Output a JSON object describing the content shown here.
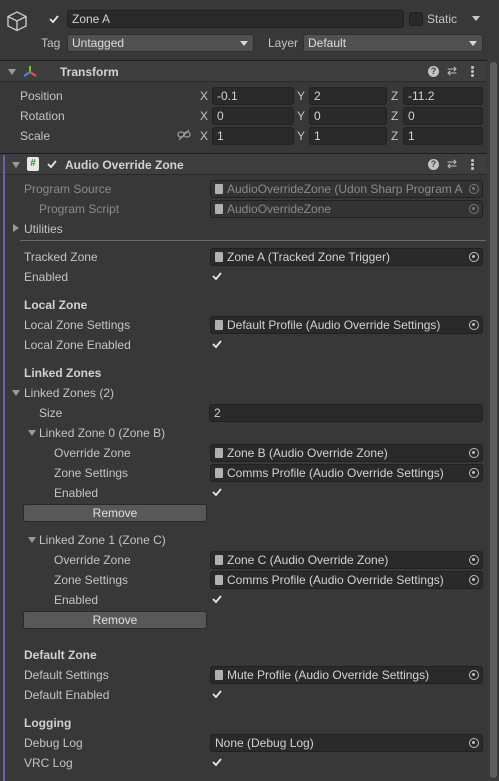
{
  "gameobject": {
    "active": true,
    "name": "Zone A",
    "static_label": "Static",
    "static_checked": false,
    "tag_label": "Tag",
    "tag_value": "Untagged",
    "layer_label": "Layer",
    "layer_value": "Default"
  },
  "transform": {
    "title": "Transform",
    "position_label": "Position",
    "rotation_label": "Rotation",
    "scale_label": "Scale",
    "axis": {
      "x": "X",
      "y": "Y",
      "z": "Z"
    },
    "position": {
      "x": "-0.1",
      "y": "2",
      "z": "-11.2"
    },
    "rotation": {
      "x": "0",
      "y": "0",
      "z": "0"
    },
    "scale": {
      "x": "1",
      "y": "1",
      "z": "1"
    }
  },
  "component": {
    "title": "Audio Override Zone",
    "enabled": true,
    "program_source_label": "Program Source",
    "program_source_value": "AudioOverrideZone (Udon Sharp Program A",
    "program_script_label": "Program Script",
    "program_script_value": "AudioOverrideZone",
    "utilities_label": "Utilities",
    "tracked_zone_label": "Tracked Zone",
    "tracked_zone_value": "Zone A (Tracked Zone Trigger)",
    "enabled_label": "Enabled",
    "enabled_checked": true,
    "local_zone_header": "Local Zone",
    "local_zone_settings_label": "Local Zone Settings",
    "local_zone_settings_value": "Default Profile (Audio Override Settings)",
    "local_zone_enabled_label": "Local Zone Enabled",
    "local_zone_enabled_checked": true,
    "linked_zones_header": "Linked Zones",
    "linked_zones_label": "Linked Zones (2)",
    "size_label": "Size",
    "size_value": "2",
    "linked": [
      {
        "label": "Linked Zone 0 (Zone B)",
        "override_label": "Override Zone",
        "override_value": "Zone B (Audio Override Zone)",
        "settings_label": "Zone Settings",
        "settings_value": "Comms Profile (Audio Override Settings)",
        "enabled_label": "Enabled",
        "enabled_checked": true,
        "remove_label": "Remove"
      },
      {
        "label": "Linked Zone 1 (Zone C)",
        "override_label": "Override Zone",
        "override_value": "Zone C (Audio Override Zone)",
        "settings_label": "Zone Settings",
        "settings_value": "Comms Profile (Audio Override Settings)",
        "enabled_label": "Enabled",
        "enabled_checked": true,
        "remove_label": "Remove"
      }
    ],
    "default_zone_header": "Default Zone",
    "default_settings_label": "Default Settings",
    "default_settings_value": "Mute Profile (Audio Override Settings)",
    "default_enabled_label": "Default Enabled",
    "default_enabled_checked": true,
    "logging_header": "Logging",
    "debug_log_label": "Debug Log",
    "debug_log_value": "None (Debug Log)",
    "vrc_log_label": "VRC Log",
    "vrc_log_checked": true
  },
  "colors": {
    "background": "#383838",
    "field": "#2a2a2a",
    "accent_bar": "#6a5fb0"
  }
}
